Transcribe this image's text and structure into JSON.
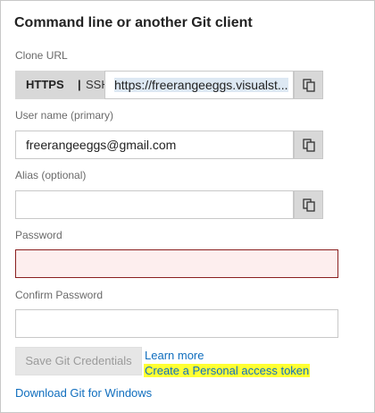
{
  "title": "Command line or another Git client",
  "clone_url": {
    "label": "Clone URL",
    "https_label": "HTTPS",
    "separator": "|",
    "ssh_label": "SSH",
    "value": "https://freerangeeggs.visualst..."
  },
  "username": {
    "label": "User name (primary)",
    "value": "freerangeeggs@gmail.com"
  },
  "alias": {
    "label": "Alias (optional)",
    "value": ""
  },
  "password": {
    "label": "Password",
    "value": ""
  },
  "confirm_password": {
    "label": "Confirm Password",
    "value": ""
  },
  "actions": {
    "save_label": "Save Git Credentials",
    "learn_more": "Learn more",
    "create_token": "Create a Personal access token",
    "download_git": "Download Git for Windows"
  },
  "colors": {
    "link": "#106ebe",
    "highlight": "#ffff33",
    "error_border": "#8a1f1f",
    "error_fill": "#fdeeee"
  },
  "icons": [
    "copy-icon"
  ]
}
